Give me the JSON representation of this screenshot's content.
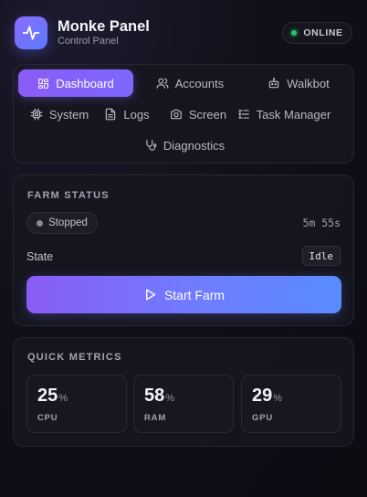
{
  "header": {
    "title": "Monke Panel",
    "subtitle": "Control Panel",
    "status": "ONLINE",
    "logo_icon": "pulse-icon"
  },
  "nav": {
    "tabs": [
      {
        "label": "Dashboard",
        "icon": "grid-icon",
        "active": true
      },
      {
        "label": "Accounts",
        "icon": "users-icon",
        "active": false
      },
      {
        "label": "Walkbot",
        "icon": "bot-icon",
        "active": false
      },
      {
        "label": "System",
        "icon": "chip-icon",
        "active": false
      },
      {
        "label": "Logs",
        "icon": "file-icon",
        "active": false
      },
      {
        "label": "Screen",
        "icon": "camera-icon",
        "active": false
      },
      {
        "label": "Task Manager",
        "icon": "list-icon",
        "active": false
      },
      {
        "label": "Diagnostics",
        "icon": "stethoscope-icon",
        "active": false
      }
    ]
  },
  "farm": {
    "title": "FARM STATUS",
    "status": "Stopped",
    "uptime": "5m 55s",
    "state_label": "State",
    "state_value": "Idle",
    "start_label": "Start Farm"
  },
  "metrics": {
    "title": "QUICK METRICS",
    "items": [
      {
        "value": "25",
        "unit": "%",
        "label": "CPU"
      },
      {
        "value": "58",
        "unit": "%",
        "label": "RAM"
      },
      {
        "value": "29",
        "unit": "%",
        "label": "GPU"
      }
    ]
  },
  "colors": {
    "accent_start": "#8a5cf6",
    "accent_end": "#5a8bff",
    "online": "#27c46b",
    "background": "#0b0b12"
  }
}
